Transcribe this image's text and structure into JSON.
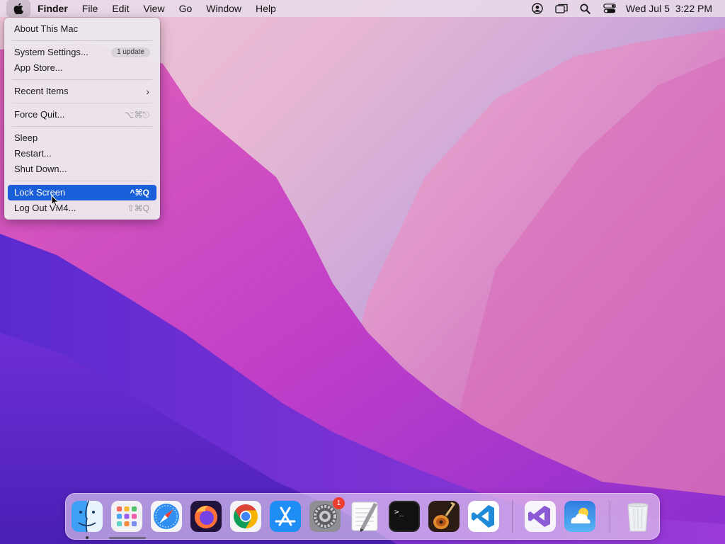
{
  "menubar": {
    "apple_icon": "apple-logo-icon",
    "items": [
      "Finder",
      "File",
      "Edit",
      "View",
      "Go",
      "Window",
      "Help"
    ],
    "status_icons": [
      "user-account-icon",
      "screen-mirroring-icon",
      "spotlight-search-icon",
      "control-center-icon"
    ],
    "date": "Wed Jul 5",
    "time": "3:22 PM"
  },
  "apple_menu": {
    "about": "About This Mac",
    "system_settings": "System Settings...",
    "system_settings_badge": "1 update",
    "app_store": "App Store...",
    "recent_items": "Recent Items",
    "recent_items_chevron": "›",
    "force_quit": "Force Quit...",
    "force_quit_shortcut": "⌥⌘⎋",
    "sleep": "Sleep",
    "restart": "Restart...",
    "shut_down": "Shut Down...",
    "lock_screen": "Lock Screen",
    "lock_screen_shortcut": "^⌘Q",
    "log_out": "Log Out VM4...",
    "log_out_shortcut": "⇧⌘Q",
    "highlighted_item": "Lock Screen"
  },
  "dock": {
    "apps": [
      "Finder",
      "Launchpad",
      "Safari",
      "Firefox",
      "Google Chrome",
      "App Store",
      "System Settings",
      "TextEdit",
      "Terminal",
      "GarageBand",
      "Visual Studio Code",
      "Visual Studio",
      "Weather",
      "Trash"
    ],
    "system_settings_badge": "1"
  },
  "colors": {
    "highlight": "#1a5fd9",
    "badge_red": "#ee3b30"
  }
}
